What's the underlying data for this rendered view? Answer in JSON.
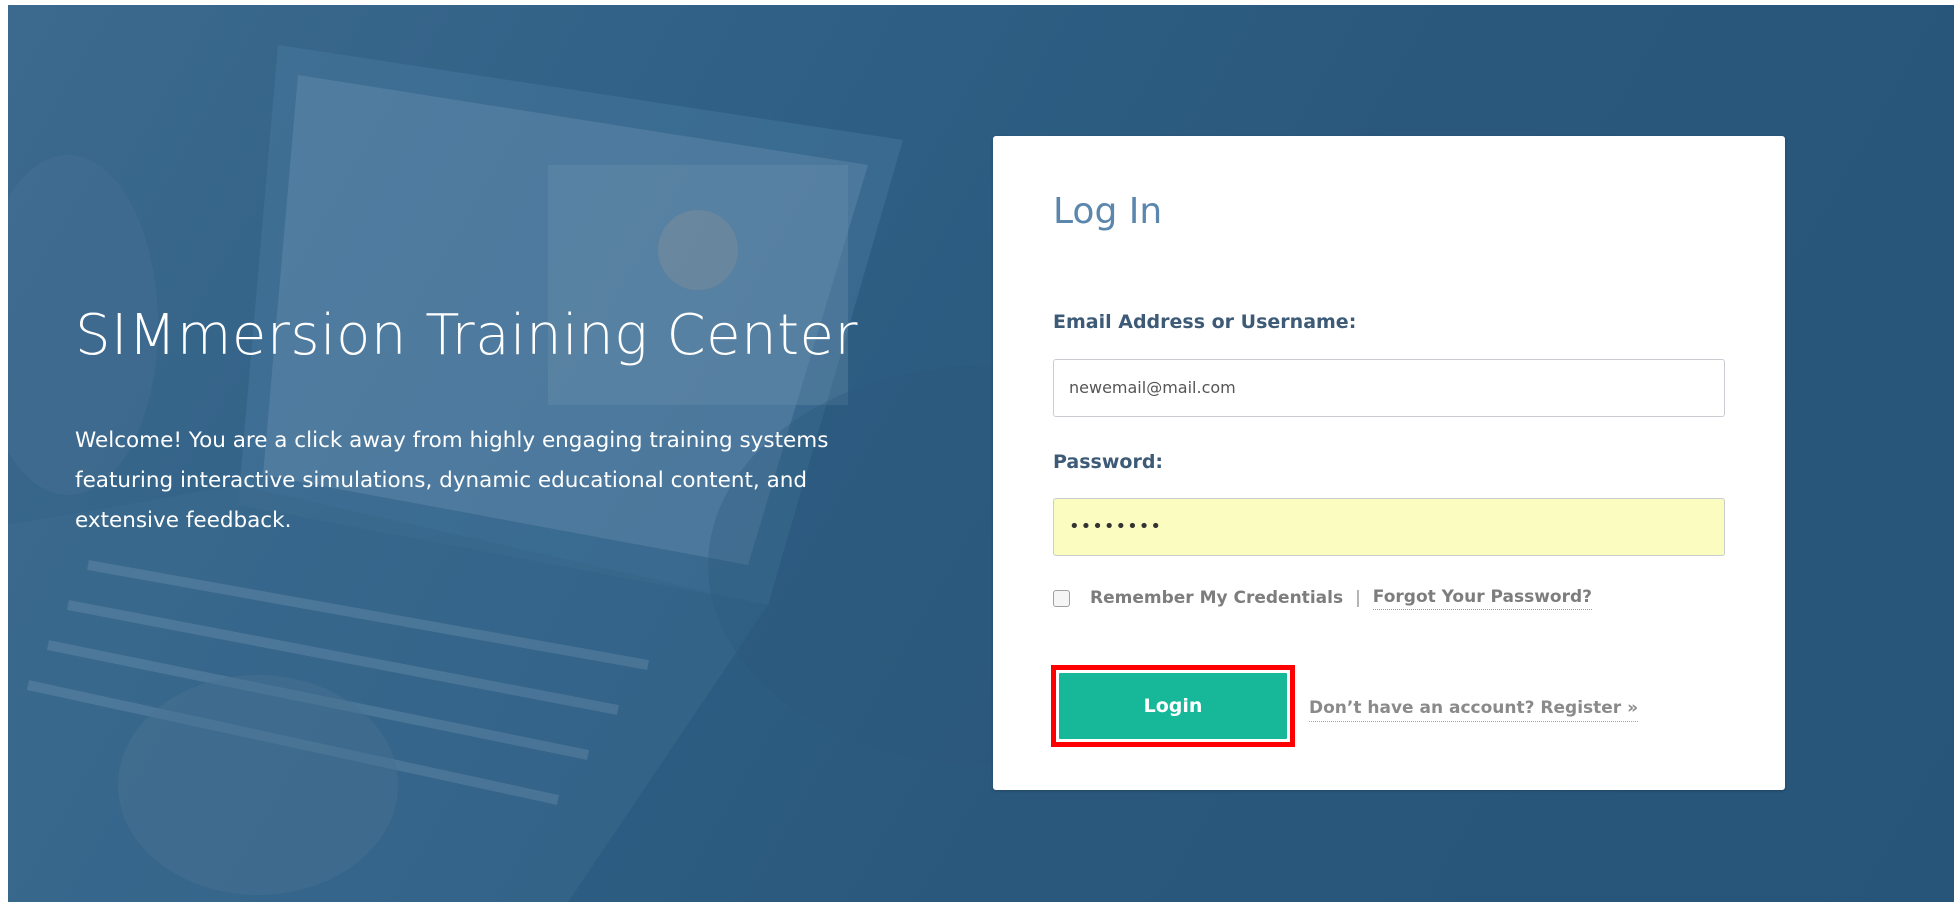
{
  "hero": {
    "title": "SIMmersion Training Center",
    "welcome": "Welcome! You are a click away from highly engaging training systems featuring interactive simulations, dynamic educational content, and extensive feedback."
  },
  "login_card": {
    "title": "Log In",
    "email_label": "Email Address or Username:",
    "email_value": "newemail@mail.com",
    "password_label": "Password:",
    "password_value": "••••••••",
    "remember_label": "Remember My Credentials",
    "separator": "|",
    "forgot_link": "Forgot Your Password?",
    "login_button": "Login",
    "register_link": "Don’t have an account? Register »"
  },
  "colors": {
    "background": "#2f5f85",
    "accent_button": "#17b79a",
    "highlight_border": "#ff0000",
    "card_title": "#5b86ad",
    "label": "#3d5a77"
  }
}
